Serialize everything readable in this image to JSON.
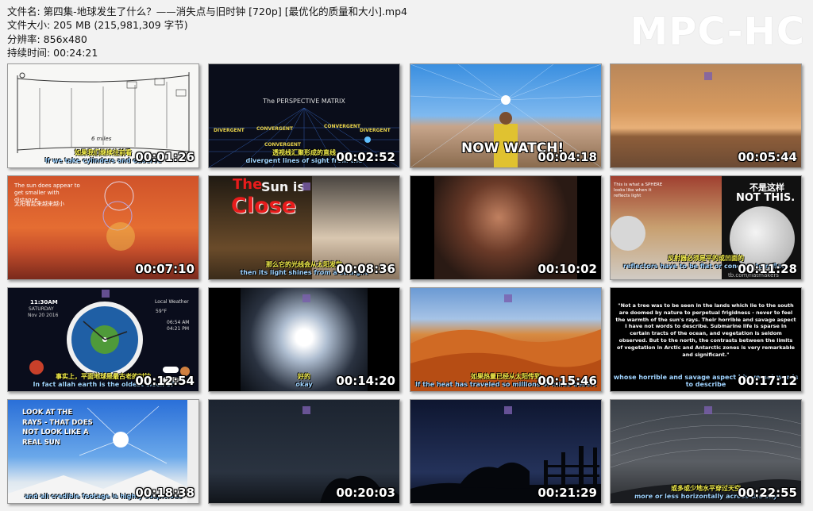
{
  "file_info": {
    "filename": "文件名: 第四集-地球发生了什么？——消失点与旧时钟 [720p] [最优化的质量和大小].mp4",
    "size": "文件大小: 205 MB (215,981,309 字节)",
    "resolution": "分辨率: 856x480",
    "duration": "持续时间: 00:24:21"
  },
  "brand": "MPC-HC",
  "thumbnails": [
    {
      "timestamp": "00:01:26",
      "sub_cn": "如果我们继续往前看",
      "sub_en": "If we take cylinders and observe",
      "label": "6 miles"
    },
    {
      "timestamp": "00:02:52",
      "sub_cn": "透视线汇聚形成的直线",
      "sub_en": "divergent lines of sight from the",
      "title": "The PERSPECTIVE MATRIX",
      "words": [
        "DIVERGENT",
        "CONVERGENT",
        "CONVERGENT",
        "DIVERGENT",
        "CONVERGENT"
      ]
    },
    {
      "timestamp": "00:04:18",
      "caption": "NOW WATCH!"
    },
    {
      "timestamp": "00:05:44"
    },
    {
      "timestamp": "00:07:10",
      "text_en": "The sun does appear to get smaller with distance.",
      "text_cn": "太阳看起来越来越小"
    },
    {
      "timestamp": "00:08:36",
      "title_1": "The",
      "title_2": "Sun is",
      "title_3": "Close",
      "sub_cn": "那么它的光线会从太阳发散",
      "sub_en": "then its light shines from a straight"
    },
    {
      "timestamp": "00:10:02"
    },
    {
      "timestamp": "00:11:28",
      "caption_left": "This is what a SPHERE looks like when it reflects light",
      "caption_right": "NOT THIS.",
      "caption_right_cn": "不是这样",
      "sub_cn": "反射器必须是平的或凹面的",
      "sub_en": "reflectors have to be flat or concave to reflect",
      "credit": "tb.com/flatmakers"
    },
    {
      "timestamp": "00:12:54",
      "clock_time": "11:30AM",
      "clock_day": "SATURDAY",
      "clock_date": "Nov 20 2016",
      "weather_title": "Local Weather",
      "weather_temp": "59°F",
      "sun_rise": "06:54 AM",
      "sun_set": "04:21 PM",
      "sub_cn": "事实上，平面地球是最古老的时钟",
      "sub_en": "In fact allah earth is the oldest clock of"
    },
    {
      "timestamp": "00:14:20",
      "sub_cn": "好的",
      "sub_en": "okay"
    },
    {
      "timestamp": "00:15:46",
      "sub_cn": "如果热量已经从太阳传到",
      "sub_en": "If the heat has traveled so millions of miles desert"
    },
    {
      "timestamp": "00:17:12",
      "quote": "\"Not a tree was to be seen in the lands which lie to the south are doomed by nature to perpetual frigidness - never to feel the warmth of the sun's rays. Their horrible and savage aspect I have not words to describe. Submarine life is sparse in certain tracts of the ocean, and vegetation is seldom observed. But to the north, the contrasts between the limits of vegetation in Arctic and Antarctic zones is very remarkable and significant.\"",
      "sub_en": "whose horrible and savage aspect I have not words to describe"
    },
    {
      "timestamp": "00:18:38",
      "caption": "LOOK AT THE RAYS - THAT DOES NOT LOOK LIKE A REAL SUN",
      "sub_en": "and all credible footage is highly suspicious"
    },
    {
      "timestamp": "00:20:03"
    },
    {
      "timestamp": "00:21:29"
    },
    {
      "timestamp": "00:22:55",
      "sub_cn": "或多或少地水平穿过天空",
      "sub_en": "more or less horizontally across the sky"
    }
  ]
}
